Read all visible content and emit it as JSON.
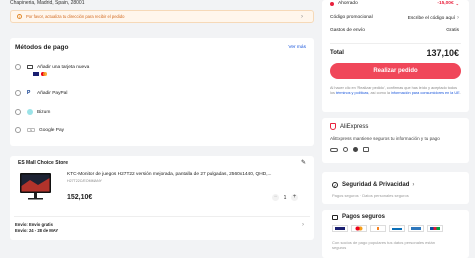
{
  "address": {
    "line": "Chapineria, Madrid, Spain, 28001",
    "warning": "Por favor, actualiza tu dirección para recibir el pedido"
  },
  "payment": {
    "title": "Métodos de pago",
    "see_more": "Ver más",
    "methods": [
      {
        "label": "Añadir una tarjeta nueva"
      },
      {
        "label": "Añadir PayPal"
      },
      {
        "label": "Bizum"
      },
      {
        "label": "Google Pay"
      }
    ]
  },
  "store": {
    "name": "ES Mall Choice Store",
    "product_title": "KTC-Monitor de juegos H27T22 versión mejorada, pantalla de 27 pulgadas, 2560x1440, QHD,...",
    "product_variant": "H27T22C/EOMMANY",
    "price": "152,10€",
    "quantity": "1",
    "shipping_line": "Envío: Envío gratis",
    "delivery_line": "Envío: 24 - 28 de MAY"
  },
  "summary": {
    "savings_label": "Ahorrado",
    "savings_value": "-15,00€",
    "promo_label": "Código promocional",
    "promo_action": "Escribe el código aquí",
    "shipping_label": "Gastos de envío",
    "shipping_value": "Gratis",
    "total_label": "Total",
    "total_value": "137,10€",
    "order_button": "Realizar pedido",
    "legal_prefix": "Al hacer clic en 'Realizar pedido', confirmas que has leído y aceptado todos los ",
    "legal_terms": "términos y políticas",
    "legal_middle": ", así como la ",
    "legal_info": "información para consumidores en la UE",
    "legal_suffix": "."
  },
  "aliexpress_box": {
    "title": "AliExpress",
    "text": "AliExpress mantiene seguros tu información y tu pago"
  },
  "security": {
    "title": "Seguridad & Privacidad",
    "subtitle": "Pagos seguros · Datos personales seguros"
  },
  "secure_payments": {
    "title": "Pagos seguros",
    "text": "Con socios de pago populares tus datos personales están seguros"
  },
  "colors": {
    "accent": "#e9213d",
    "order_button": "#f0475a",
    "link": "#1a56db"
  }
}
